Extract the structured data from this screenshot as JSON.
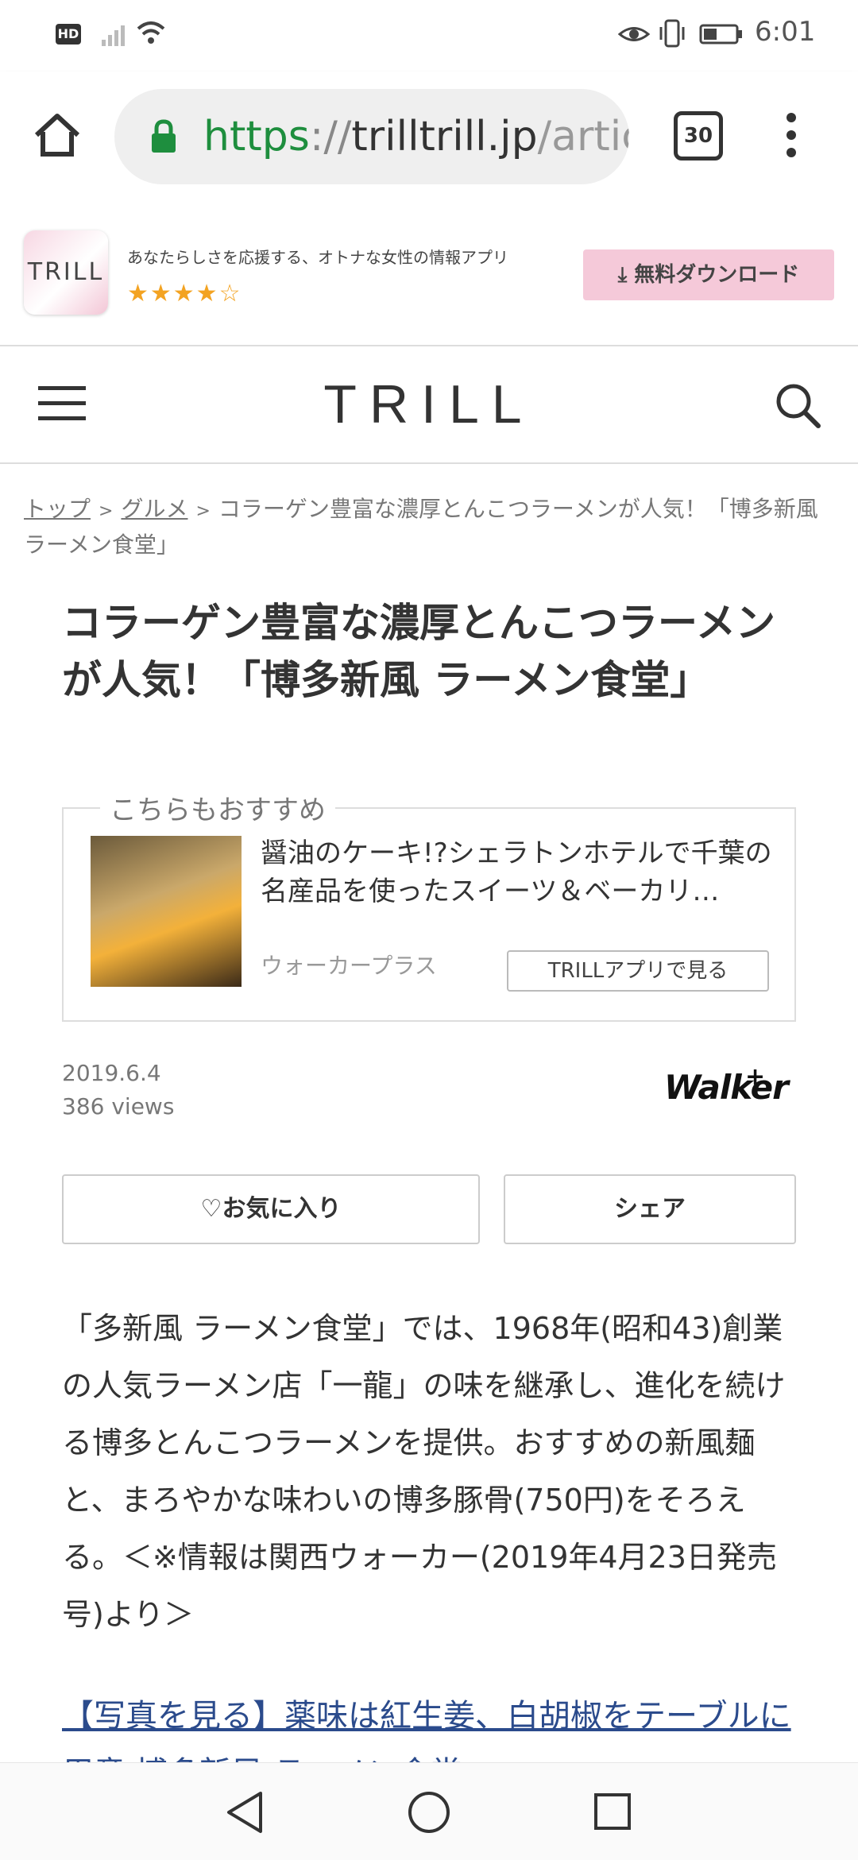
{
  "status_bar": {
    "hd": "HD",
    "time": "6:01",
    "icons": [
      "hd-icon",
      "signal-icon",
      "wifi-icon",
      "eye-icon",
      "vibrate-icon",
      "battery-icon"
    ]
  },
  "browser": {
    "url_scheme": "https",
    "url_sep": "://",
    "url_host": "trilltrill.jp",
    "url_path": "/articles",
    "tab_count": "30"
  },
  "app_banner": {
    "icon_text": "TRILL",
    "tagline": "あなたらしさを応援する、オトナな女性の情報アプリ",
    "rating": 4.5,
    "stars": "★★★★☆",
    "download_label": "⤓ 無料ダウンロード"
  },
  "header": {
    "logo": "TRILL"
  },
  "breadcrumb": {
    "top": "トップ",
    "sep": ">",
    "category": "グルメ",
    "current": "コラーゲン豊富な濃厚とんこつラーメンが人気！「博多新風 ラーメン食堂」"
  },
  "article": {
    "title": "コラーゲン豊富な濃厚とんこつラーメンが人気！「博多新風 ラーメン食堂」",
    "date": "2019.6.4",
    "views": "386 views",
    "publisher_logo": "Walker",
    "publisher_plus": "+",
    "favorite_label": "♡お気に入り",
    "share_label": "シェア",
    "body": "「多新風 ラーメン食堂」では、1968年(昭和43)創業の人気ラーメン店「一龍」の味を継承し、進化を続ける博多とんこつラーメンを提供。おすすめの新風麺と、まろやかな味わいの博多豚骨(750円)をそろえる。＜※情報は関西ウォーカー(2019年4月23日発売号)より＞",
    "link": "【写真を見る】薬味は紅生姜、白胡椒をテーブルに用意 博多新風 ラーメン食堂"
  },
  "recommendation": {
    "label": "こちらもおすすめ",
    "title": "醤油のケーキ!?シェラトンホテルで千葉の名産品を使ったスイーツ＆ベーカリ…",
    "source": "ウォーカープラス",
    "button": "TRILLアプリで見る"
  },
  "colors": {
    "https_green": "#1e8e3e",
    "star_orange": "#f3a322",
    "download_pink": "#f5c9d9",
    "link_blue": "#2b4b8c"
  }
}
